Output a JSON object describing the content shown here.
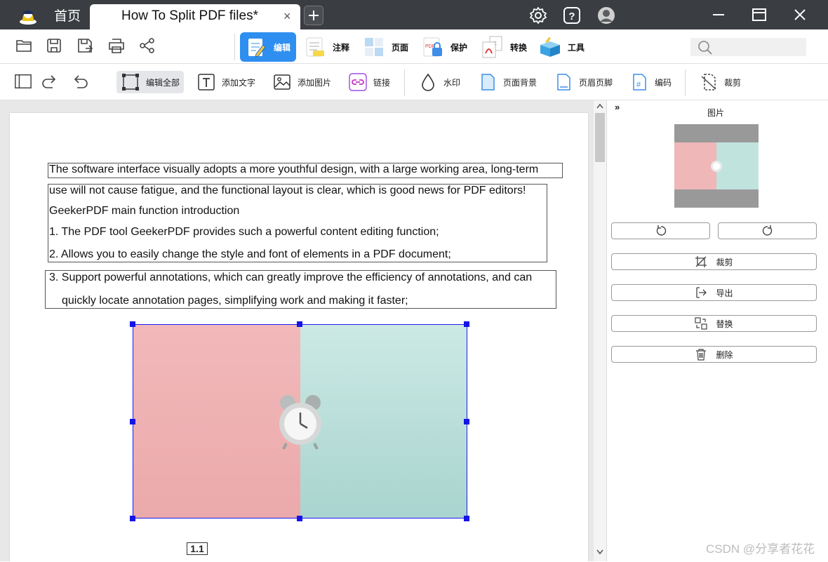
{
  "titlebar": {
    "home_tab": "首页",
    "doc_tab": "How To Split PDF files*",
    "close_tab": "×"
  },
  "main_tabs": [
    {
      "label": "编辑",
      "icon": "edit-doc-icon",
      "active": true
    },
    {
      "label": "注释",
      "icon": "annotate-icon",
      "active": false
    },
    {
      "label": "页面",
      "icon": "pages-icon",
      "active": false
    },
    {
      "label": "保护",
      "icon": "protect-pdf-icon",
      "active": false
    },
    {
      "label": "转换",
      "icon": "convert-icon",
      "active": false
    },
    {
      "label": "工具",
      "icon": "toolbox-icon",
      "active": false
    }
  ],
  "edit_toolbar": [
    {
      "label": "编辑全部",
      "icon": "edit-all-icon",
      "selected": true
    },
    {
      "label": "添加文字",
      "icon": "add-text-icon"
    },
    {
      "label": "添加图片",
      "icon": "add-image-icon"
    },
    {
      "label": "链接",
      "icon": "link-icon"
    },
    {
      "label": "水印",
      "icon": "watermark-icon"
    },
    {
      "label": "页面背景",
      "icon": "page-background-icon"
    },
    {
      "label": "页眉页脚",
      "icon": "header-footer-icon"
    },
    {
      "label": "编码",
      "icon": "bates-number-icon"
    },
    {
      "label": "裁剪",
      "icon": "crop-icon"
    }
  ],
  "document": {
    "lines": [
      "The software interface visually adopts a more youthful design, with a large working area, long-term",
      "use will not cause fatigue, and the functional layout is clear, which is good news for PDF editors!",
      "GeekerPDF main function introduction",
      "1. The PDF tool GeekerPDF provides such a powerful content editing function;",
      "2. Allows you to easily change the style and font of elements in a PDF document;",
      "3. Support powerful annotations, which can greatly improve the efficiency of annotations, and can",
      "quickly locate annotation pages, simplifying work and making it faster;"
    ],
    "page_number": "1.1"
  },
  "panel": {
    "collapse": "»",
    "title": "图片",
    "buttons": {
      "crop": "裁剪",
      "export": "导出",
      "replace": "替换",
      "delete": "删除"
    }
  },
  "watermark": "CSDN @分享者花花",
  "colors": {
    "accent": "#2e8ff0",
    "titlebar": "#3a3d42",
    "selection": "#1414e6"
  }
}
